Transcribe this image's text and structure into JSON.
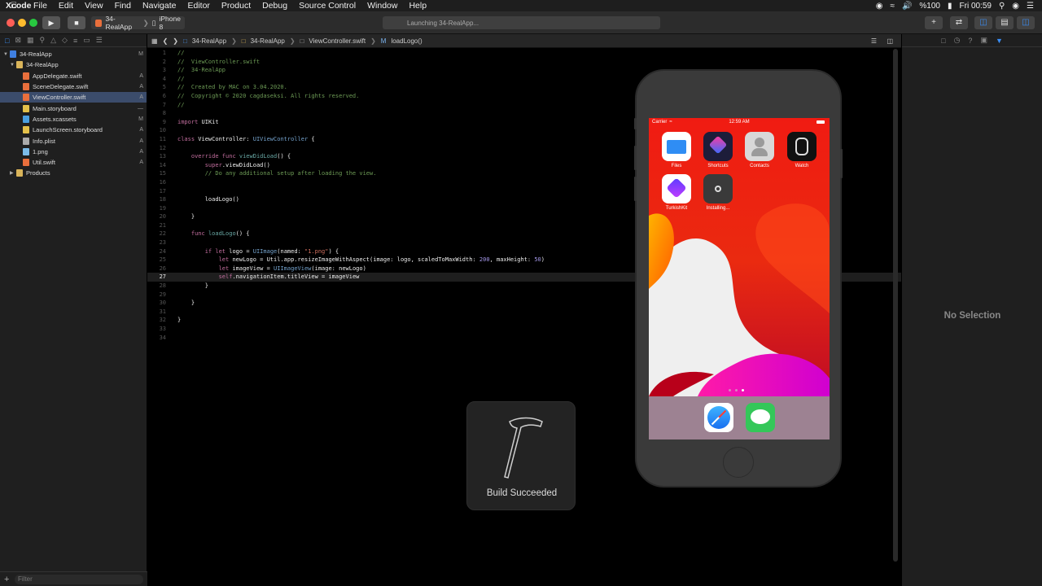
{
  "menubar": {
    "app_name": "Xcode",
    "items": [
      "File",
      "Edit",
      "View",
      "Find",
      "Navigate",
      "Editor",
      "Product",
      "Debug",
      "Source Control",
      "Window",
      "Help"
    ],
    "battery": "%100",
    "clock": "Fri 00:59"
  },
  "toolbar": {
    "scheme": "34-RealApp",
    "device": "iPhone 8",
    "activity": "Launching 34-RealApp..."
  },
  "navigator": {
    "rows": [
      {
        "label": "34-RealApp",
        "status": "M",
        "level": 0,
        "kind": "project"
      },
      {
        "label": "34-RealApp",
        "status": "",
        "level": 1,
        "kind": "folder"
      },
      {
        "label": "AppDelegate.swift",
        "status": "A",
        "level": 2,
        "kind": "swift"
      },
      {
        "label": "SceneDelegate.swift",
        "status": "A",
        "level": 2,
        "kind": "swift"
      },
      {
        "label": "ViewController.swift",
        "status": "A",
        "level": 2,
        "kind": "swift"
      },
      {
        "label": "Main.storyboard",
        "status": "—",
        "level": 2,
        "kind": "storyboard"
      },
      {
        "label": "Assets.xcassets",
        "status": "M",
        "level": 2,
        "kind": "assets"
      },
      {
        "label": "LaunchScreen.storyboard",
        "status": "A",
        "level": 2,
        "kind": "storyboard"
      },
      {
        "label": "Info.plist",
        "status": "A",
        "level": 2,
        "kind": "plist"
      },
      {
        "label": "1.png",
        "status": "A",
        "level": 2,
        "kind": "image"
      },
      {
        "label": "Util.swift",
        "status": "A",
        "level": 2,
        "kind": "swift"
      },
      {
        "label": "Products",
        "status": "",
        "level": 1,
        "kind": "folder"
      }
    ],
    "filter_placeholder": "Filter"
  },
  "jumpbar": {
    "crumbs": [
      "34-RealApp",
      "34-RealApp",
      "ViewController.swift",
      "loadLogo()"
    ]
  },
  "code": {
    "current_line": 27,
    "lines": [
      "//",
      "//  ViewController.swift",
      "//  34-RealApp",
      "//",
      "//  Created by MAC on 3.04.2020.",
      "//  Copyright © 2020 cagdaseksi. All rights reserved.",
      "//",
      "",
      "import UIKit",
      "",
      "class ViewController: UIViewController {",
      "",
      "    override func viewDidLoad() {",
      "        super.viewDidLoad()",
      "        // Do any additional setup after loading the view.",
      "",
      "",
      "        loadLogo()",
      "",
      "    }",
      "",
      "    func loadLogo() {",
      "",
      "        if let logo = UIImage(named: \"1.png\") {",
      "            let newLogo = Util.app.resizeImageWithAspect(image: logo, scaledToMaxWidth: 200, maxHeight: 50)",
      "            let imageView = UIImageView(image: newLogo)",
      "            self.navigationItem.titleView = imageView",
      "        }",
      "",
      "    }",
      "",
      "}",
      "",
      ""
    ]
  },
  "inspector": {
    "empty_label": "No Selection"
  },
  "simulator": {
    "carrier": "Carrier",
    "time": "12:59 AM",
    "apps": [
      {
        "label": "Files",
        "icon": "files-icon"
      },
      {
        "label": "Shortcuts",
        "icon": "shortcuts-icon"
      },
      {
        "label": "Contacts",
        "icon": "contacts-icon"
      },
      {
        "label": "Watch",
        "icon": "watch-icon"
      },
      {
        "label": "TurkishKit",
        "icon": "turkishkit-icon"
      },
      {
        "label": "Installing...",
        "icon": "installing-icon"
      }
    ],
    "dock": [
      {
        "icon": "safari-icon"
      },
      {
        "icon": "messages-icon"
      }
    ]
  },
  "hud": {
    "message": "Build Succeeded"
  }
}
